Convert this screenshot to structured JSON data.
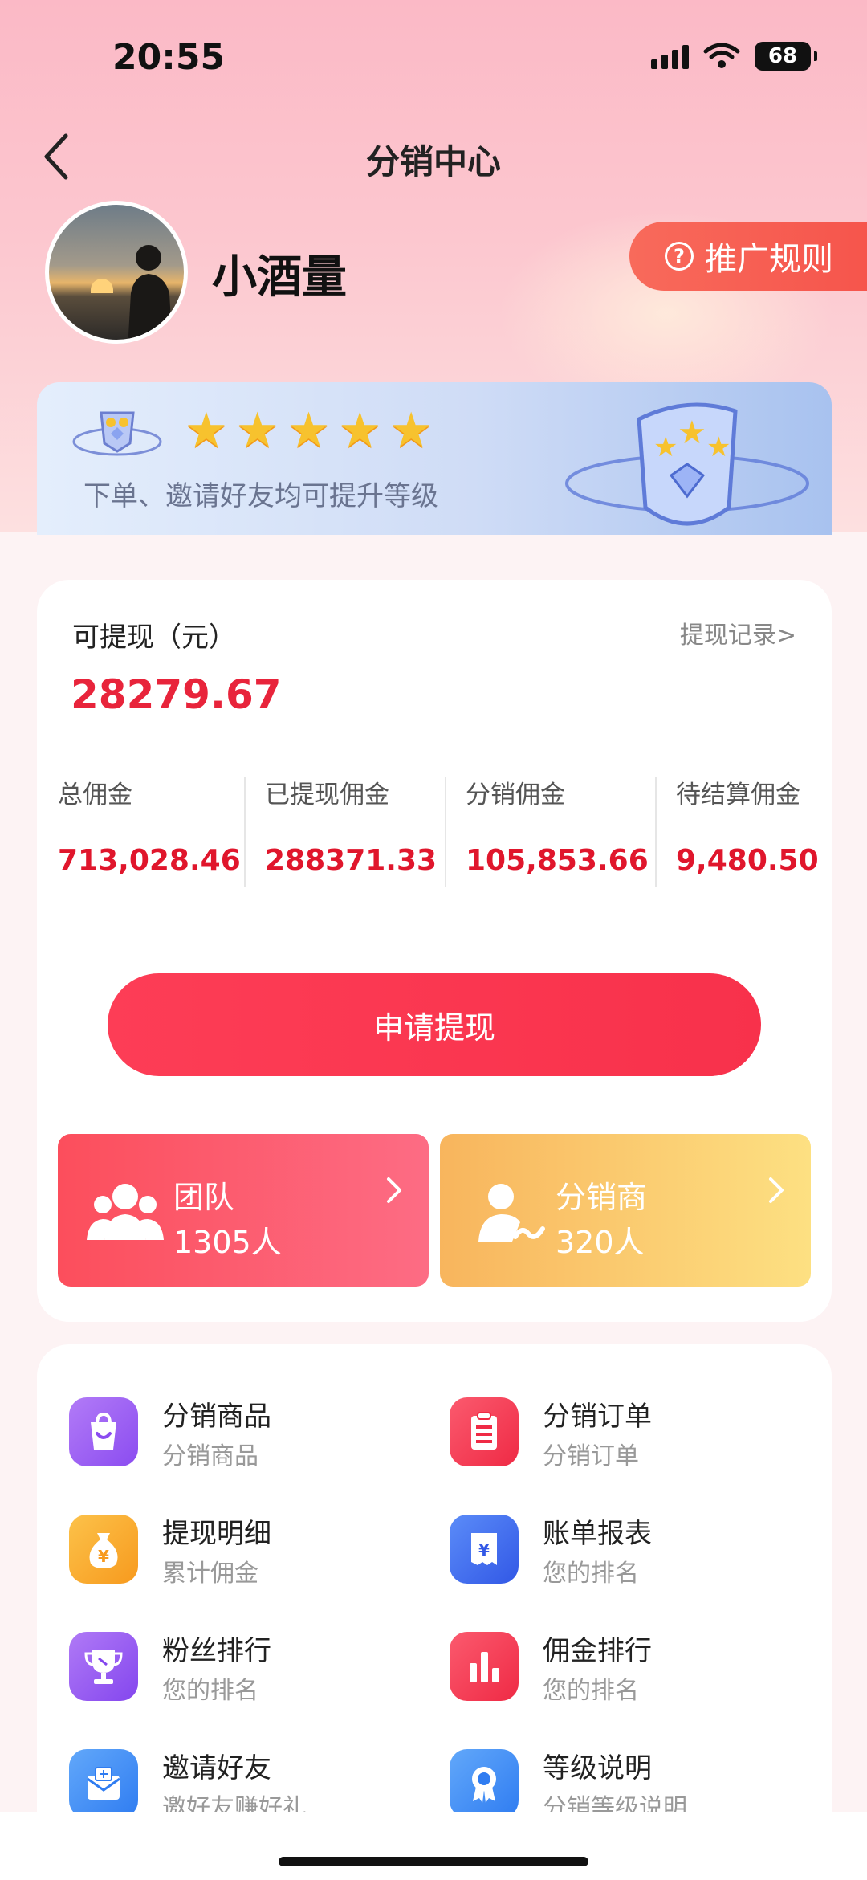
{
  "status_bar": {
    "time": "20:55",
    "battery": "68"
  },
  "nav": {
    "title": "分销中心"
  },
  "profile": {
    "name": "小酒量",
    "rules_label": "推广规则"
  },
  "level_banner": {
    "tip": "下单、邀请好友均可提升等级",
    "stars": 5
  },
  "wallet": {
    "label": "可提现（元）",
    "record_link": "提现记录>",
    "amount": "28279.67",
    "stats": [
      {
        "label": "总佣金",
        "value": "713,028.46"
      },
      {
        "label": "已提现佣金",
        "value": "288371.33"
      },
      {
        "label": "分销佣金",
        "value": "105,853.66"
      },
      {
        "label": "待结算佣金",
        "value": "9,480.50"
      }
    ],
    "withdraw_button": "申请提现",
    "team": {
      "name": "团队",
      "count": "1305人"
    },
    "distributor": {
      "name": "分销商",
      "count": "320人"
    }
  },
  "menu": [
    {
      "title": "分销商品",
      "sub": "分销商品",
      "icon": "shopping-bag-icon",
      "color": "#9b5cf6"
    },
    {
      "title": "分销订单",
      "sub": "分销订单",
      "icon": "clipboard-icon",
      "color": "#f5374f"
    },
    {
      "title": "提现明细",
      "sub": "累计佣金",
      "icon": "money-bag-icon",
      "color": "#f8a623"
    },
    {
      "title": "账单报表",
      "sub": "您的排名",
      "icon": "bill-icon",
      "color": "#3d6df2"
    },
    {
      "title": "粉丝排行",
      "sub": "您的排名",
      "icon": "trophy-icon",
      "color": "#9a52f2"
    },
    {
      "title": "佣金排行",
      "sub": "您的排名",
      "icon": "bar-chart-icon",
      "color": "#f5374f"
    },
    {
      "title": "邀请好友",
      "sub": "邀好友赚好礼",
      "icon": "envelope-icon",
      "color": "#3f8df5"
    },
    {
      "title": "等级说明",
      "sub": "分销等级说明",
      "icon": "badge-icon",
      "color": "#3f8df5"
    }
  ]
}
